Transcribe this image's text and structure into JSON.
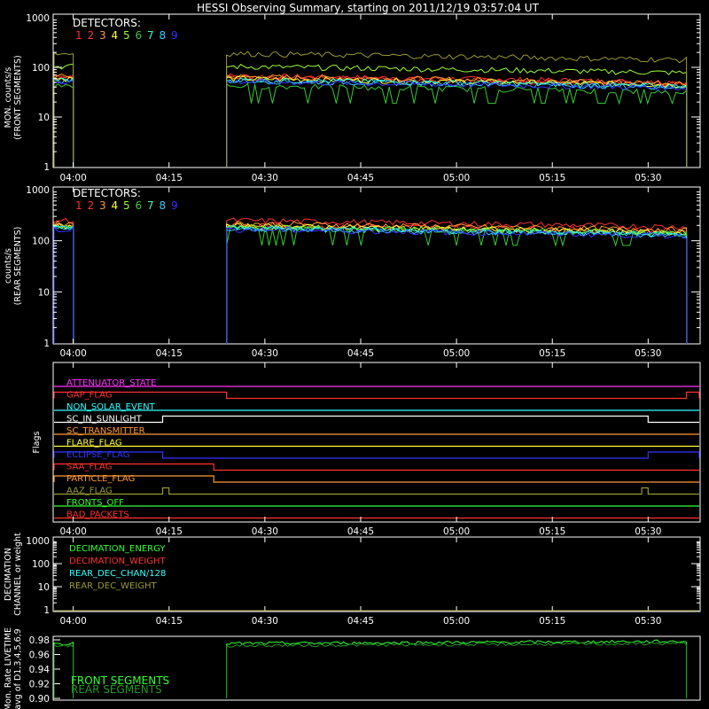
{
  "title": "HESSI Observing Summary, starting on 2011/12/19 03:57:04 UT",
  "chart_data": [
    {
      "type": "line",
      "panel": "front",
      "ylabel": [
        "MON. counts/s",
        "(FRONT SEGMENTS)"
      ],
      "yscale": "log",
      "ylim": [
        1,
        1000
      ],
      "yticks": [
        "1000",
        "100",
        "10",
        "1"
      ],
      "xticks": [
        "04:00",
        "04:15",
        "04:30",
        "04:45",
        "05:00",
        "05:15",
        "05:30"
      ],
      "legend_title": "DETECTORS:",
      "detectors": [
        "1",
        "2",
        "3",
        "4",
        "5",
        "6",
        "7",
        "8",
        "9"
      ],
      "colors": [
        "#ff3030",
        "#ff3030",
        "#ff9933",
        "#ffff33",
        "#99ff33",
        "#33cc33",
        "#33ffcc",
        "#33ccff",
        "#3333ff"
      ],
      "intervals": [
        [
          "03:57",
          "04:00"
        ],
        [
          "04:24",
          "05:36"
        ]
      ],
      "series": [
        {
          "color": "#ff3030",
          "level": 62
        },
        {
          "color": "#ff3030",
          "level": 58
        },
        {
          "color": "#ff9933",
          "level": 60
        },
        {
          "color": "#ffff33",
          "level": 55
        },
        {
          "color": "#99ff33",
          "level": 95
        },
        {
          "color": "#33cc33",
          "level": 40
        },
        {
          "color": "#33ffcc",
          "level": 52
        },
        {
          "color": "#33ccff",
          "level": 50
        },
        {
          "color": "#3333ff",
          "level": 48
        },
        {
          "color": "#999933",
          "level": 170
        }
      ]
    },
    {
      "type": "line",
      "panel": "rear",
      "ylabel": [
        "counts/s",
        "(REAR SEGMENTS)"
      ],
      "yscale": "log",
      "ylim": [
        1,
        1000
      ],
      "yticks": [
        "1000",
        "100",
        "10",
        "1"
      ],
      "xticks": [
        "04:00",
        "04:15",
        "04:30",
        "04:45",
        "05:00",
        "05:15",
        "05:30"
      ],
      "legend_title": "DETECTORS:",
      "detectors": [
        "1",
        "2",
        "3",
        "4",
        "5",
        "6",
        "7",
        "8",
        "9"
      ],
      "colors": [
        "#ff3030",
        "#ff3030",
        "#ff9933",
        "#ffff33",
        "#99ff33",
        "#33cc33",
        "#33ffcc",
        "#33ccff",
        "#3333ff"
      ],
      "intervals": [
        [
          "03:57",
          "04:00"
        ],
        [
          "04:24",
          "05:36"
        ]
      ],
      "series": [
        {
          "color": "#ff3030",
          "level": 230
        },
        {
          "color": "#ff3030",
          "level": 190
        },
        {
          "color": "#ff9933",
          "level": 200
        },
        {
          "color": "#ffff33",
          "level": 180
        },
        {
          "color": "#99ff33",
          "level": 175
        },
        {
          "color": "#33cc33",
          "level": 170
        },
        {
          "color": "#33ffcc",
          "level": 165
        },
        {
          "color": "#33ccff",
          "level": 160
        },
        {
          "color": "#3333ff",
          "level": 155
        }
      ]
    },
    {
      "type": "flags",
      "ylabel": "Flags",
      "xticks": [
        "04:00",
        "04:15",
        "04:30",
        "04:45",
        "05:00",
        "05:15",
        "05:30"
      ],
      "flags": [
        {
          "name": "ATTENUATOR_STATE",
          "color": "#ff33ff",
          "segments": []
        },
        {
          "name": "GAP_FLAG",
          "color": "#ff3030",
          "segments": [
            [
              "03:57",
              "04:24"
            ],
            [
              "05:36",
              "05:38"
            ]
          ]
        },
        {
          "name": "NON_SOLAR_EVENT",
          "color": "#33ffff",
          "segments": []
        },
        {
          "name": "SC_IN_SUNLIGHT",
          "color": "#ffffff",
          "segments": [
            [
              "04:14",
              "05:30"
            ]
          ]
        },
        {
          "name": "SC_TRANSMITTER",
          "color": "#ff9933",
          "segments": []
        },
        {
          "name": "FLARE_FLAG",
          "color": "#ffff33",
          "segments": []
        },
        {
          "name": "ECLIPSE_FLAG",
          "color": "#3333ff",
          "segments": [
            [
              "03:57",
              "04:14"
            ],
            [
              "05:30",
              "05:38"
            ]
          ]
        },
        {
          "name": "SAA_FLAG",
          "color": "#ff3030",
          "segments": [
            [
              "03:57",
              "04:22"
            ]
          ]
        },
        {
          "name": "PARTICLE_FLAG",
          "color": "#ff9933",
          "segments": [
            [
              "03:57",
              "04:22"
            ]
          ]
        },
        {
          "name": "AAZ_FLAG",
          "color": "#999933",
          "segments": [
            [
              "04:14",
              "04:15"
            ],
            [
              "05:29",
              "05:30"
            ]
          ]
        },
        {
          "name": "FRONTS_OFF",
          "color": "#33ff33",
          "segments": []
        },
        {
          "name": "BAD_PACKETS",
          "color": "#ff3030",
          "segments": []
        }
      ]
    },
    {
      "type": "line",
      "panel": "decimation",
      "ylabel": [
        "DECIMATION",
        "CHANNEL or weight"
      ],
      "yscale": "log",
      "ylim": [
        1,
        1000
      ],
      "yticks": [
        "1000",
        "100",
        "10",
        "1"
      ],
      "xticks": [
        "04:00",
        "04:15",
        "04:30",
        "04:45",
        "05:00",
        "05:15",
        "05:30"
      ],
      "series": [
        {
          "name": "DECIMATION_ENERGY",
          "color": "#33ff33"
        },
        {
          "name": "DECIMATION_WEIGHT",
          "color": "#ff3030"
        },
        {
          "name": "REAR_DEC_CHAN/128",
          "color": "#33ffff"
        },
        {
          "name": "REAR_DEC_WEIGHT",
          "color": "#999933"
        }
      ]
    },
    {
      "type": "line",
      "panel": "livetime",
      "ylabel": [
        "Mon. Rate LIVETIME",
        "avg of D1,3,4,5,6,9"
      ],
      "ylim": [
        0.9,
        0.98
      ],
      "yticks": [
        "0.98",
        "0.96",
        "0.94",
        "0.92",
        "0.90"
      ],
      "series": [
        {
          "name": "FRONT SEGMENTS",
          "color": "#33ff33",
          "level": 0.975
        },
        {
          "name": "REAR SEGMENTS",
          "color": "#229922",
          "level": 0.972
        }
      ]
    }
  ]
}
